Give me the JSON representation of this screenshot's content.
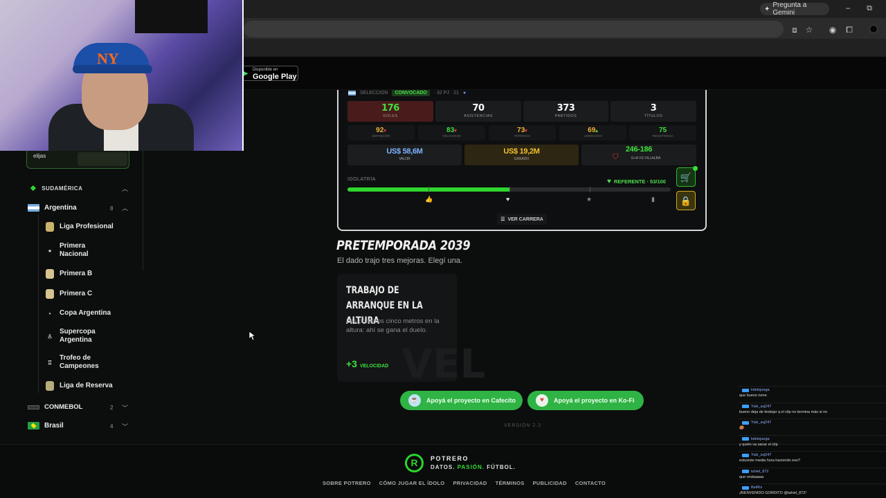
{
  "browser": {
    "gemini_label": "Pregunta a Gemini"
  },
  "header": {
    "gplay_small": "Disponible en",
    "gplay_big": "Google Play"
  },
  "sidebar": {
    "promo_text": "elijas",
    "region": "SUDAMÉRICA",
    "country": {
      "name": "Argentina",
      "count": "8"
    },
    "leagues": [
      "Liga Profesional",
      "Primera Nacional",
      "Primera B",
      "Primera C",
      "Copa Argentina",
      "Supercopa Argentina",
      "Trofeo de Campeones",
      "Liga de Reserva"
    ],
    "others": [
      {
        "name": "CONMEBOL",
        "count": "2"
      },
      {
        "name": "Brasil",
        "count": "4"
      }
    ],
    "twitter_icon": "X"
  },
  "card": {
    "seleccion": "SELECCION",
    "convocado": "CONVOCADO",
    "seleccion_meta": "· 32 PJ · 21",
    "stats": [
      {
        "value": "176",
        "label": "GOLES"
      },
      {
        "value": "70",
        "label": "ASISTENCIAS"
      },
      {
        "value": "373",
        "label": "PARTIDOS"
      },
      {
        "value": "3",
        "label": "TÍTULOS"
      }
    ],
    "attributes": [
      {
        "value": "92",
        "arrow": "▾",
        "label": "DEFINICIÓN",
        "color": "#f5b43a"
      },
      {
        "value": "83",
        "arrow": "▾",
        "label": "VELOCIDAD",
        "color": "#3ee03e"
      },
      {
        "value": "73",
        "arrow": "▾",
        "label": "POTENCIA",
        "color": "#f5b43a"
      },
      {
        "value": "69",
        "arrow": "▴",
        "label": "LIDERAZGO",
        "color": "#f5b43a"
      },
      {
        "value": "75",
        "arrow": "",
        "label": "RESISTENCIA",
        "color": "#3ee03e"
      }
    ],
    "valor": {
      "value": "US$ 58,6M",
      "label": "VALOR"
    },
    "ganado": {
      "value": "US$ 19,2M",
      "label": "GANADO"
    },
    "rival": {
      "value": "246-186",
      "label": "G+A VS VILLALBA"
    },
    "idolatria_label": "IDOLATRÍA",
    "referente": "REFERENTE · 53/100",
    "idolatria_progress": 0.53,
    "ver_carrera": "VER CARRERA"
  },
  "pretemporada": {
    "title": "PRETEMPORADA 2039",
    "subtitle": "El dado trajo tres mejoras. Elegí una.",
    "choice": {
      "title": "TRABAJO DE ARRANQUE EN LA ALTURA",
      "description": "Los primeros cinco metros en la altura: ahí se gana el duelo.",
      "bonus": "+3",
      "bonus_label": "VELOCIDAD",
      "watermark": "VEL"
    }
  },
  "support": {
    "cafecito": "Apoyá el proyecto en Cafecito",
    "kofi": "Apoyá el proyecto en Ko-Fi"
  },
  "version": "VERSIÓN 2.2",
  "footer": {
    "brand": "POTRERO",
    "tag_a": "DATOS.",
    "tag_b": "PASIÓN.",
    "tag_c": "FÚTBOL.",
    "links": [
      "SOBRE POTRERO",
      "CÓMO JUGAR EL ÍDOLO",
      "PRIVACIDAD",
      "TÉRMINOS",
      "PUBLICIDAD",
      "CONTACTO"
    ]
  },
  "chat": [
    {
      "user": "lobitojuega",
      "msg": "que bueno nene"
    },
    {
      "user": "Yuki_ssj247",
      "msg": "bueno deja de festejar q el clip no termina más si no"
    },
    {
      "user": "Yuki_ssj247",
      "msg": "🥵"
    },
    {
      "user": "lobitojuega",
      "msg": "y quién va sacar el clip"
    },
    {
      "user": "Yuki_ssj247",
      "msg": "estuviste media hora haciendo eso?"
    },
    {
      "user": "tahiel_872",
      "msg": "que ondaaaaa"
    },
    {
      "user": "BetRix",
      "msg": "¡BIENVENIDO GORDITO @tahiel_872!"
    }
  ]
}
